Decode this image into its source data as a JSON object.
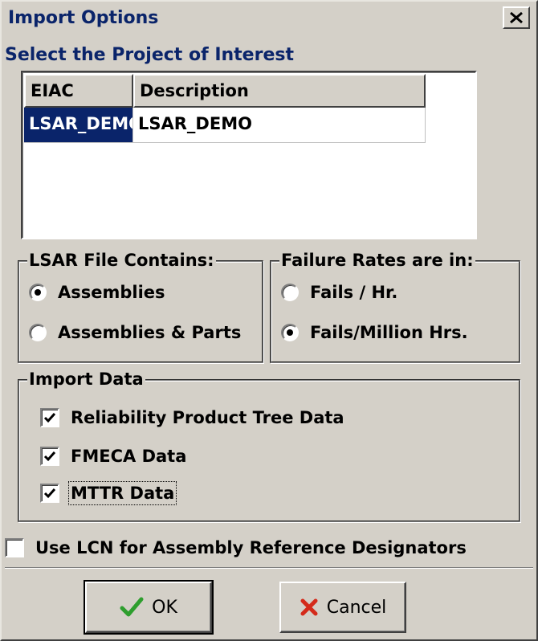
{
  "window": {
    "title": "Import Options"
  },
  "prompt": "Select the Project of Interest",
  "grid": {
    "columns": [
      "EIAC",
      "Description"
    ],
    "rows": [
      {
        "eiac": "LSAR_DEMO",
        "description": "LSAR_DEMO"
      }
    ]
  },
  "file_contents": {
    "label": "LSAR File Contains:",
    "options": [
      "Assemblies",
      "Assemblies & Parts"
    ],
    "selected": "Assemblies"
  },
  "failure_rates": {
    "label": "Failure Rates are in:",
    "options": [
      "Fails / Hr.",
      "Fails/Million Hrs."
    ],
    "selected": "Fails/Million Hrs."
  },
  "import_data": {
    "label": "Import Data",
    "items": [
      {
        "label": "Reliability Product Tree Data",
        "checked": true
      },
      {
        "label": "FMECA Data",
        "checked": true
      },
      {
        "label": "MTTR Data",
        "checked": true
      }
    ]
  },
  "use_lcn": {
    "label": "Use LCN for Assembly Reference Designators",
    "checked": false
  },
  "buttons": {
    "ok": "OK",
    "cancel": "Cancel"
  },
  "colors": {
    "selection": "#0a246a",
    "face": "#d4d0c8",
    "ok_icon": "#2e9e2e",
    "cancel_icon": "#d42a1a"
  },
  "icons": {
    "close": "close-icon",
    "ok": "checkmark-icon",
    "cancel": "x-icon"
  }
}
